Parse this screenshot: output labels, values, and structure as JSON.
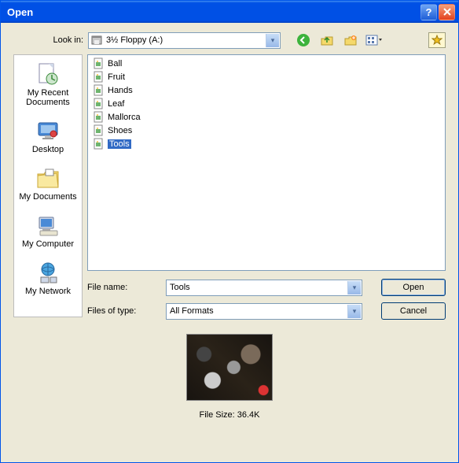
{
  "title": "Open",
  "lookin": {
    "label": "Look in:",
    "value": "3½ Floppy (A:)"
  },
  "toolbar_icons": [
    "back-icon",
    "up-icon",
    "new-folder-icon",
    "views-icon"
  ],
  "favorites_icon": "favorites-icon",
  "places": [
    {
      "label": "My Recent Documents",
      "icon": "recent"
    },
    {
      "label": "Desktop",
      "icon": "desktop"
    },
    {
      "label": "My Documents",
      "icon": "mydocs"
    },
    {
      "label": "My Computer",
      "icon": "computer"
    },
    {
      "label": "My Network",
      "icon": "network"
    }
  ],
  "files": [
    {
      "name": "Ball",
      "selected": false
    },
    {
      "name": "Fruit",
      "selected": false
    },
    {
      "name": "Hands",
      "selected": false
    },
    {
      "name": "Leaf",
      "selected": false
    },
    {
      "name": "Mallorca",
      "selected": false
    },
    {
      "name": "Shoes",
      "selected": false
    },
    {
      "name": "Tools",
      "selected": true
    }
  ],
  "fields": {
    "file_name_label": "File name:",
    "file_name_value": "Tools",
    "file_type_label": "Files of type:",
    "file_type_value": "All Formats"
  },
  "buttons": {
    "open": "Open",
    "cancel": "Cancel"
  },
  "preview": {
    "size_label": "File Size: 36.4K"
  }
}
